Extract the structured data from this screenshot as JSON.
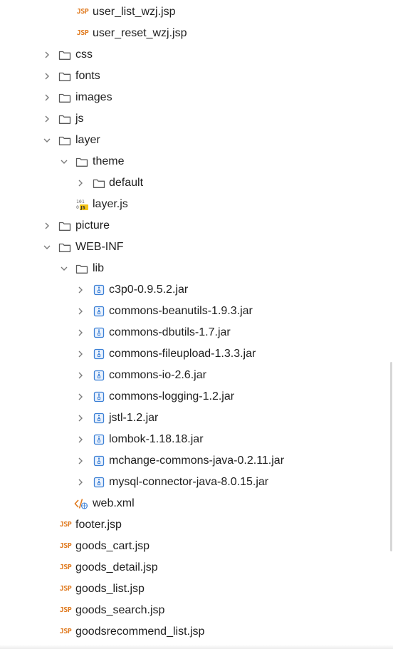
{
  "tree": [
    {
      "label": "user_list_wzj.jsp",
      "icon": "jsp-file-icon",
      "depth": 2,
      "chevron": "none"
    },
    {
      "label": "user_reset_wzj.jsp",
      "icon": "jsp-file-icon",
      "depth": 2,
      "chevron": "none"
    },
    {
      "label": "css",
      "icon": "folder-icon",
      "depth": 1,
      "chevron": "collapsed"
    },
    {
      "label": "fonts",
      "icon": "folder-icon",
      "depth": 1,
      "chevron": "collapsed"
    },
    {
      "label": "images",
      "icon": "folder-icon",
      "depth": 1,
      "chevron": "collapsed"
    },
    {
      "label": "js",
      "icon": "folder-icon",
      "depth": 1,
      "chevron": "collapsed"
    },
    {
      "label": "layer",
      "icon": "folder-icon",
      "depth": 1,
      "chevron": "expanded"
    },
    {
      "label": "theme",
      "icon": "folder-icon",
      "depth": 2,
      "chevron": "expanded"
    },
    {
      "label": "default",
      "icon": "folder-icon",
      "depth": 3,
      "chevron": "collapsed"
    },
    {
      "label": "layer.js",
      "icon": "js-file-icon",
      "depth": 2,
      "chevron": "none"
    },
    {
      "label": "picture",
      "icon": "folder-icon",
      "depth": 1,
      "chevron": "collapsed"
    },
    {
      "label": "WEB-INF",
      "icon": "folder-icon",
      "depth": 1,
      "chevron": "expanded"
    },
    {
      "label": "lib",
      "icon": "folder-icon",
      "depth": 2,
      "chevron": "expanded"
    },
    {
      "label": "c3p0-0.9.5.2.jar",
      "icon": "jar-archive-icon",
      "depth": 3,
      "chevron": "collapsed"
    },
    {
      "label": "commons-beanutils-1.9.3.jar",
      "icon": "jar-archive-icon",
      "depth": 3,
      "chevron": "collapsed"
    },
    {
      "label": "commons-dbutils-1.7.jar",
      "icon": "jar-archive-icon",
      "depth": 3,
      "chevron": "collapsed"
    },
    {
      "label": "commons-fileupload-1.3.3.jar",
      "icon": "jar-archive-icon",
      "depth": 3,
      "chevron": "collapsed"
    },
    {
      "label": "commons-io-2.6.jar",
      "icon": "jar-archive-icon",
      "depth": 3,
      "chevron": "collapsed"
    },
    {
      "label": "commons-logging-1.2.jar",
      "icon": "jar-archive-icon",
      "depth": 3,
      "chevron": "collapsed"
    },
    {
      "label": "jstl-1.2.jar",
      "icon": "jar-archive-icon",
      "depth": 3,
      "chevron": "collapsed"
    },
    {
      "label": "lombok-1.18.18.jar",
      "icon": "jar-archive-icon",
      "depth": 3,
      "chevron": "collapsed"
    },
    {
      "label": "mchange-commons-java-0.2.11.jar",
      "icon": "jar-archive-icon",
      "depth": 3,
      "chevron": "collapsed"
    },
    {
      "label": "mysql-connector-java-8.0.15.jar",
      "icon": "jar-archive-icon",
      "depth": 3,
      "chevron": "collapsed"
    },
    {
      "label": "web.xml",
      "icon": "xml-file-icon",
      "depth": 2,
      "chevron": "none"
    },
    {
      "label": "footer.jsp",
      "icon": "jsp-file-icon",
      "depth": 1,
      "chevron": "none"
    },
    {
      "label": "goods_cart.jsp",
      "icon": "jsp-file-icon",
      "depth": 1,
      "chevron": "none"
    },
    {
      "label": "goods_detail.jsp",
      "icon": "jsp-file-icon",
      "depth": 1,
      "chevron": "none"
    },
    {
      "label": "goods_list.jsp",
      "icon": "jsp-file-icon",
      "depth": 1,
      "chevron": "none"
    },
    {
      "label": "goods_search.jsp",
      "icon": "jsp-file-icon",
      "depth": 1,
      "chevron": "none"
    },
    {
      "label": "goodsrecommend_list.jsp",
      "icon": "jsp-file-icon",
      "depth": 1,
      "chevron": "none"
    }
  ],
  "icon_text": {
    "jsp": "JSP",
    "js_top": "101",
    "js_bottom": "0",
    "js_badge": "JS"
  },
  "colors": {
    "jsp_icon": "#e07a1f",
    "jar_icon": "#3a7fd5",
    "folder_stroke": "#5a5a5a",
    "chevron": "#7a7a7a",
    "xml_bracket": "#e07a1f",
    "xml_globe": "#3a7fd5"
  }
}
